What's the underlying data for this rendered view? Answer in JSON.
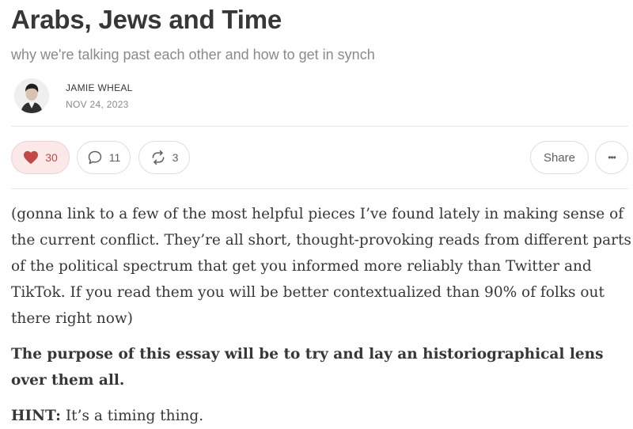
{
  "post": {
    "title": "Arabs, Jews and Time",
    "subtitle": "why we're talking past each other and how to get in synch",
    "author": "JAMIE WHEAL",
    "date": "NOV 24, 2023"
  },
  "actions": {
    "likes": "30",
    "comments": "11",
    "restacks": "3",
    "share_label": "Share",
    "more_label": "•••"
  },
  "content": {
    "p1": "(gonna link to a few of the most helpful pieces I’ve found lately in making sense of the current conflict. They’re all short, thought-provoking reads from different parts of the political spectrum that get you informed more reliably than Twitter and TikTok. If you read them you will be better contextualized than 90% of folks out there right now)",
    "p2": "The purpose of this essay will be to try and lay an historiographical lens over them all.",
    "p3_label": "HINT:",
    "p3_text": " It’s a timing thing."
  },
  "icons": {
    "like": "heart-icon",
    "comment": "speech-bubble-icon",
    "restack": "repost-icon",
    "more": "ellipsis-icon"
  },
  "colors": {
    "like_accent": "#c24848",
    "like_background": "#fbe9e9",
    "text": "#363737",
    "muted": "#8a8a8a"
  }
}
